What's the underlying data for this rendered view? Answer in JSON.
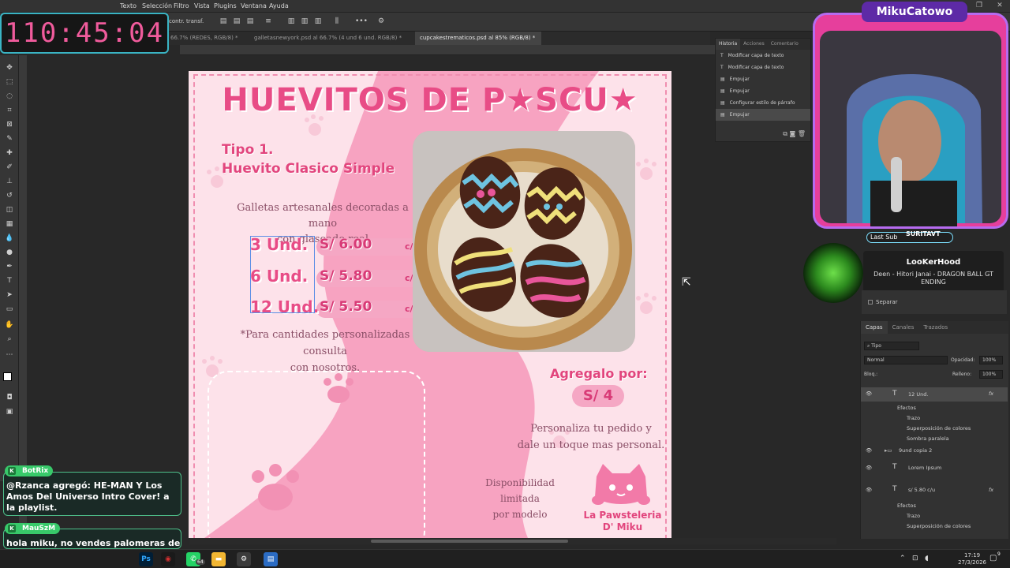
{
  "app": {
    "menu": [
      "Texto",
      "Selección",
      "Filtro",
      "Vista",
      "Plugins",
      "Ventana",
      "Ayuda"
    ],
    "options_label": "contr. transf.",
    "window_controls": [
      "—",
      "❐",
      "✕"
    ]
  },
  "tabs": [
    {
      "label": "66.7% (REDES, RGB/8) *",
      "active": false
    },
    {
      "label": "galletasnewyork.psd al 66.7% (4 und   6 und. RGB/8) *",
      "active": false
    },
    {
      "label": "cupcakestrematicos.psd al 85% (RGB/8) *",
      "active": true
    }
  ],
  "timer": "110:45:04",
  "design": {
    "title": "HUEVITOS DE P★SCU★",
    "type_line1": "Tipo 1.",
    "type_line2": "Huevito Clasico Simple",
    "desc_line1": "Galletas artesanales decoradas a mano",
    "desc_line2": "con glaseado real",
    "prices": [
      {
        "qty": "3 Und.",
        "price": "S/ 6.00",
        "unit": "c/u"
      },
      {
        "qty": "6 Und.",
        "price": "S/ 5.80",
        "unit": "c/u"
      },
      {
        "qty": "12 Und.",
        "price": "S/ 5.50",
        "unit": "c/u"
      }
    ],
    "note_line1": "*Para cantidades personalizadas consulta",
    "note_line2": "con nosotros.",
    "add_label": "Agregalo por:",
    "add_price": "S/ 4",
    "personal_line1": "Personaliza tu pedido y",
    "personal_line2": "dale un toque mas personal.",
    "avail_line1": "Disponibilidad limitada",
    "avail_line2": "por modelo",
    "brand_line1": "La Pawsteleria",
    "brand_line2": "D' Miku"
  },
  "history": {
    "tabs": [
      "Historia",
      "Acciones",
      "Comentario"
    ],
    "items": [
      {
        "label": "Modificar capa de texto",
        "icon": "T"
      },
      {
        "label": "Modificar capa de texto",
        "icon": "T"
      },
      {
        "label": "Empujar",
        "icon": "▤"
      },
      {
        "label": "Empujar",
        "icon": "▤"
      },
      {
        "label": "Configurar estilo de párrafo",
        "icon": "▤"
      },
      {
        "label": "Empujar",
        "icon": "▤"
      }
    ]
  },
  "stream": {
    "channel": "MikuCatowo",
    "last_sub_label": "Last Sub",
    "last_sub_name": "SURITAVT",
    "music_artist": "LooKerHood",
    "music_song": "Deen - Hitori Janai - DRAGON BALL GT ENDING"
  },
  "props": {
    "separar": "Separar"
  },
  "layers": {
    "tabs": [
      "Capas",
      "Canales",
      "Trazados"
    ],
    "filter": "Tipo",
    "blend": "Normal",
    "opacity_label": "Opacidad:",
    "opacity": "100%",
    "lock_label": "Bloq.:",
    "fill_label": "Relleno:",
    "fill": "100%",
    "rows": [
      {
        "name": "12 Und.",
        "kind": "text",
        "fx": "fx"
      },
      {
        "name": "Efectos",
        "kind": "effects"
      },
      {
        "name": "Trazo",
        "kind": "effect"
      },
      {
        "name": "Superposición de colores",
        "kind": "effect"
      },
      {
        "name": "Sombra paralela",
        "kind": "effect"
      },
      {
        "name": "9und copia 2",
        "kind": "group"
      },
      {
        "name": "Lorem Ipsum",
        "kind": "text"
      },
      {
        "name": "s/ 5.80 c/u",
        "kind": "text",
        "fx": "fx"
      },
      {
        "name": "Efectos",
        "kind": "effects"
      },
      {
        "name": "Trazo",
        "kind": "effect"
      },
      {
        "name": "Superposición de colores",
        "kind": "effect"
      }
    ]
  },
  "chat": [
    {
      "user": "BotRix",
      "message": "@Rzanca agregó: HE-MAN Y Los Amos Del Universo Intro Cover! a la playlist."
    },
    {
      "user": "MauSzM",
      "message": "hola miku, no vendes palomeras de yoshi pa la peli de mario? xd"
    }
  ],
  "taskbar": {
    "time": "17:19",
    "date": "27/3/2026",
    "notif_count": "9",
    "whatsapp_badge": "64"
  },
  "colors": {
    "accent_pink": "#e84c86",
    "bg_pink": "#fde2ea",
    "panel": "#323232"
  }
}
